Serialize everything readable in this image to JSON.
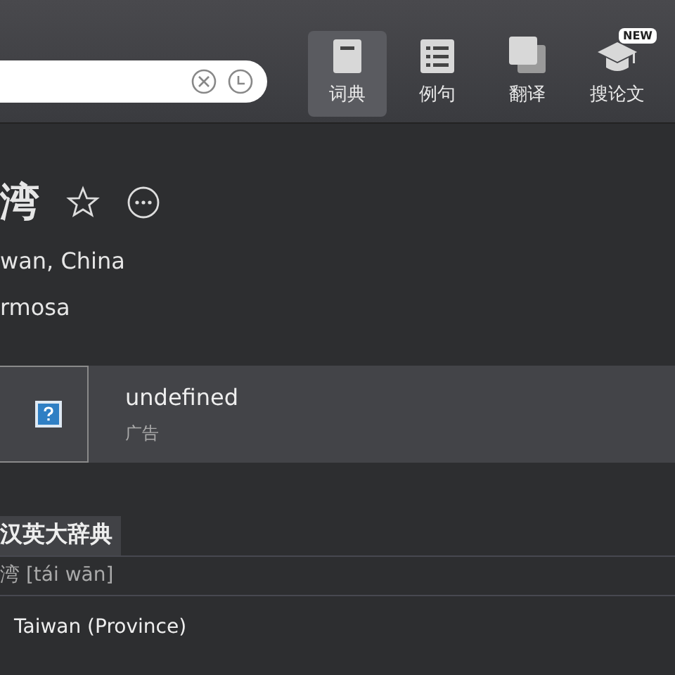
{
  "tabs": [
    {
      "label": "词典",
      "kind": "book",
      "selected": true
    },
    {
      "label": "例句",
      "kind": "list",
      "selected": false
    },
    {
      "label": "翻译",
      "kind": "copy",
      "selected": false
    },
    {
      "label": "搜论文",
      "kind": "cap",
      "selected": false,
      "badge": "NEW"
    }
  ],
  "entry": {
    "headword": "湾",
    "definitions": [
      "wan, China",
      "rmosa"
    ]
  },
  "ad": {
    "title": "undefined",
    "label": "广告"
  },
  "dictionary": {
    "name": "汉英大辞典",
    "pronunciation": "湾 [tái wān]",
    "meanings": [
      "Taiwan (Province)"
    ]
  }
}
